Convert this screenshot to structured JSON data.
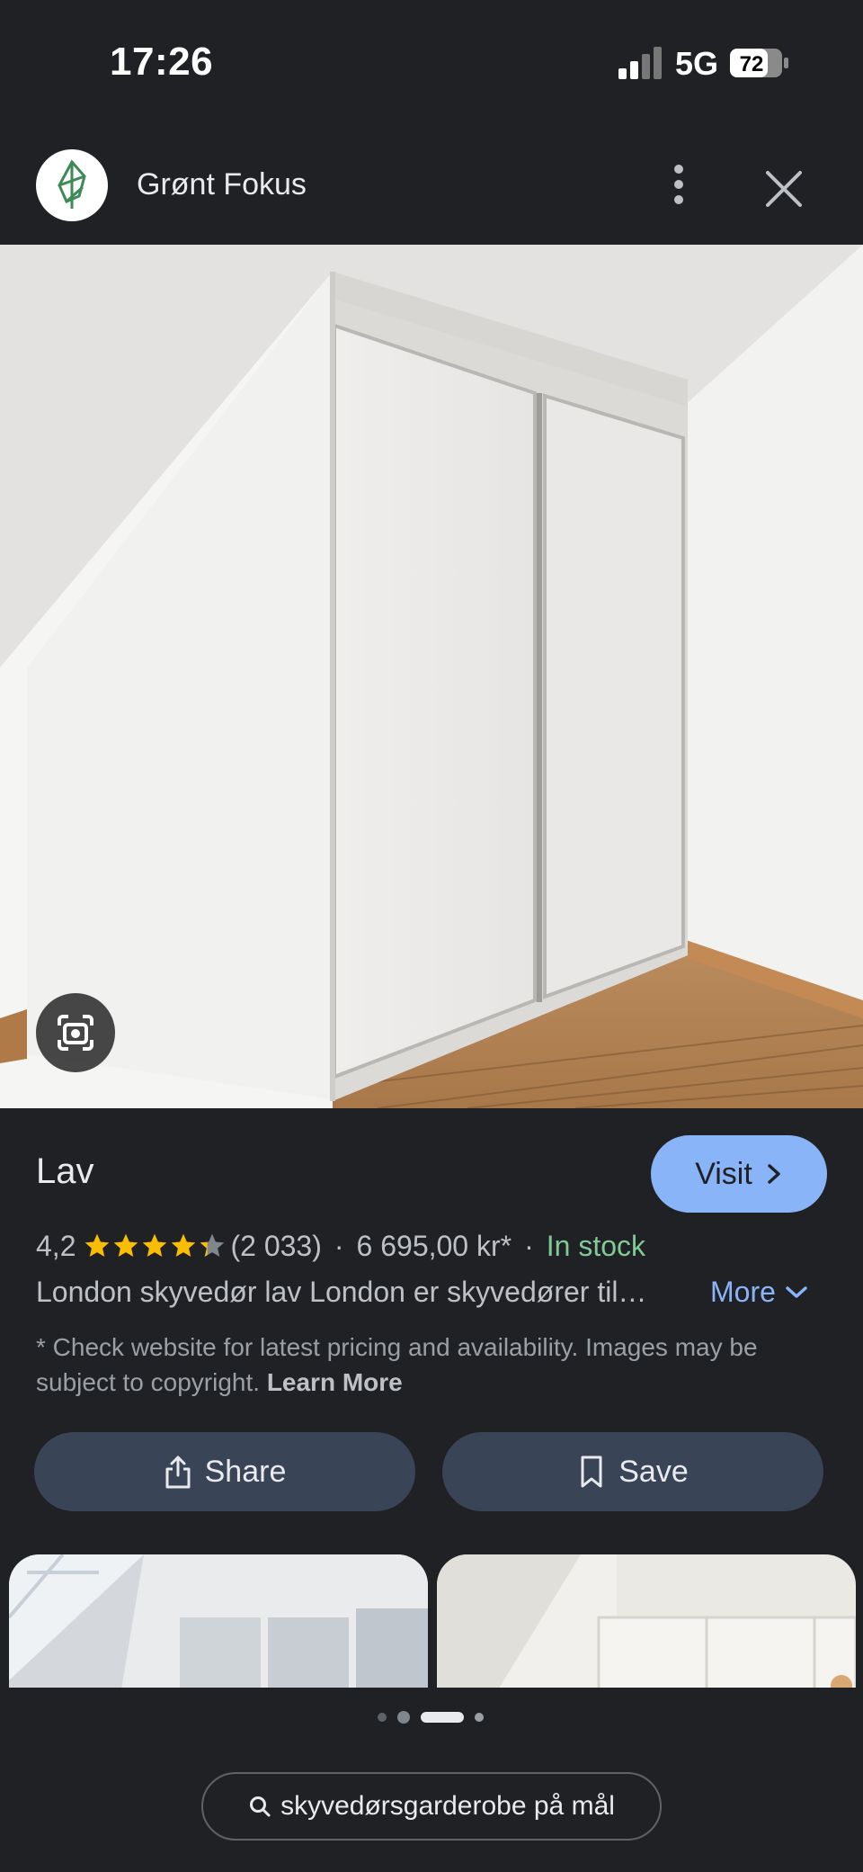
{
  "status_bar": {
    "time": "17:26",
    "network": "5G",
    "battery": "72"
  },
  "header": {
    "site_name": "Grønt Fokus",
    "menu_icon": "more-vert-icon",
    "close_icon": "close-icon"
  },
  "hero": {
    "lens_icon": "google-lens-icon"
  },
  "product": {
    "title": "Lav",
    "visit_label": "Visit",
    "rating": "4,2",
    "stars": 4.2,
    "review_count": "(2 033)",
    "separator": "·",
    "price": "6 695,00 kr*",
    "stock": "In stock",
    "description": "London skyvedør lav London er skyvedører til…",
    "more_label": "More",
    "disclaimer": "* Check website for latest pricing and availability. Images may be subject to copyright.",
    "learn_more": "Learn More"
  },
  "actions": {
    "share_label": "Share",
    "save_label": "Save"
  },
  "pager": {
    "active_index": 2,
    "count": 4
  },
  "search": {
    "query": "skyvedørsgarderobe på mål"
  },
  "colors": {
    "accent": "#8ab4f8",
    "stock": "#81c995",
    "background": "#202124",
    "button": "#394457"
  }
}
